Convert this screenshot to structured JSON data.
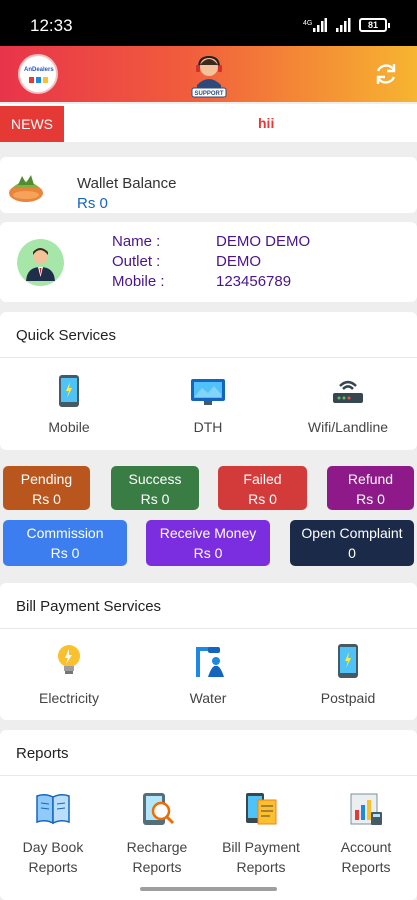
{
  "status_bar": {
    "time": "12:33",
    "battery": "81"
  },
  "header": {
    "logo_text": "AnDealers"
  },
  "news": {
    "label": "NEWS",
    "text": "hii"
  },
  "wallet": {
    "label": "Wallet Balance",
    "value": "Rs 0"
  },
  "profile": {
    "name_label": "Name :",
    "name": "DEMO DEMO",
    "outlet_label": "Outlet :",
    "outlet": "DEMO",
    "mobile_label": "Mobile :",
    "mobile": "123456789"
  },
  "quick_services": {
    "title": "Quick Services",
    "items": [
      {
        "label": "Mobile",
        "icon": "mobile-icon"
      },
      {
        "label": "DTH",
        "icon": "dth-icon"
      },
      {
        "label": "Wifi/Landline",
        "icon": "router-icon"
      }
    ]
  },
  "stats": [
    {
      "label": "Pending",
      "value": "Rs 0",
      "color": "#b9561d"
    },
    {
      "label": "Success",
      "value": "Rs 0",
      "color": "#3a7d44"
    },
    {
      "label": "Failed",
      "value": "Rs 0",
      "color": "#d33b3b"
    },
    {
      "label": "Refund",
      "value": "Rs 0",
      "color": "#8e1a8a"
    },
    {
      "label": "Commission",
      "value": "Rs 0",
      "color": "#3c7ef0"
    },
    {
      "label": "Receive Money",
      "value": "Rs 0",
      "color": "#7b2ee0"
    },
    {
      "label": "Open Complaint",
      "value": "0",
      "color": "#1c2a4a"
    }
  ],
  "bill_payment": {
    "title": "Bill Payment Services",
    "items": [
      {
        "label": "Electricity",
        "icon": "bulb-icon"
      },
      {
        "label": "Water",
        "icon": "water-icon"
      },
      {
        "label": "Postpaid",
        "icon": "postpaid-icon"
      }
    ]
  },
  "reports": {
    "title": "Reports",
    "items": [
      {
        "line1": "Day Book",
        "line2": "Reports",
        "icon": "daybook-icon"
      },
      {
        "line1": "Recharge",
        "line2": "Reports",
        "icon": "recharge-report-icon"
      },
      {
        "line1": "Bill Payment",
        "line2": "Reports",
        "icon": "bill-report-icon"
      },
      {
        "line1": "Account",
        "line2": "Reports",
        "icon": "account-report-icon"
      }
    ]
  }
}
